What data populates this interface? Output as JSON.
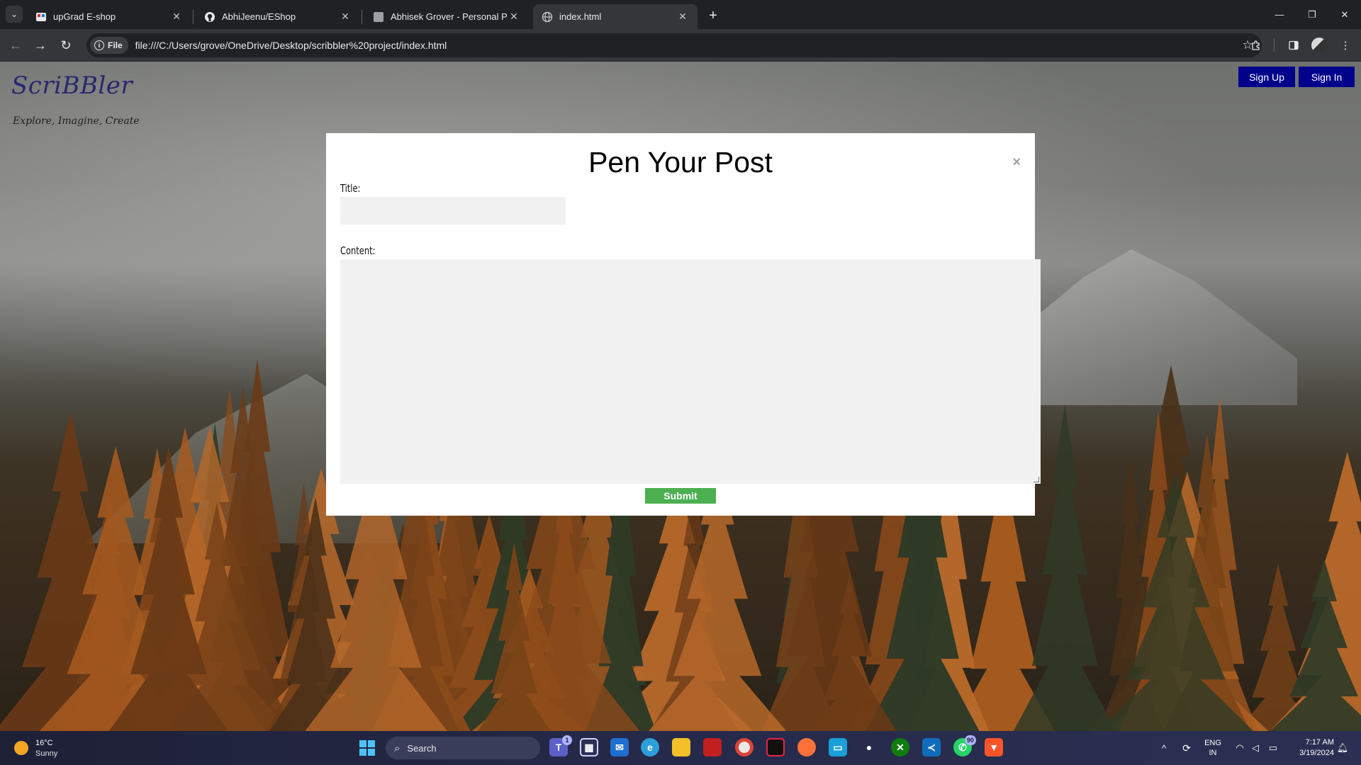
{
  "browser": {
    "tabs": [
      {
        "title": "upGrad E-shop",
        "active": false
      },
      {
        "title": "AbhiJeenu/EShop",
        "active": false
      },
      {
        "title": "Abhisek Grover - Personal Portf",
        "active": false
      },
      {
        "title": "index.html",
        "active": true
      }
    ],
    "site_chip": "File",
    "url": "file:///C:/Users/grove/OneDrive/Desktop/scribbler%20project/index.html"
  },
  "page": {
    "logo": "ScriBBler",
    "tagline": "Explore, Imagine, Create",
    "sign_up": "Sign Up",
    "sign_in": "Sign In",
    "modal": {
      "title": "Pen Your Post",
      "close": "×",
      "title_label": "Title:",
      "content_label": "Content:",
      "submit": "Submit"
    }
  },
  "taskbar": {
    "weather_temp": "16°C",
    "weather_condition": "Sunny",
    "search": "Search",
    "teams_badge": "1",
    "whatsapp_badge": "90",
    "language": "ENG",
    "region": "IN",
    "time": "7:17 AM",
    "date": "3/19/2024"
  },
  "colors": {
    "button_blue": "#00008b",
    "submit_green": "#4caf50",
    "logo": "#27276f"
  }
}
